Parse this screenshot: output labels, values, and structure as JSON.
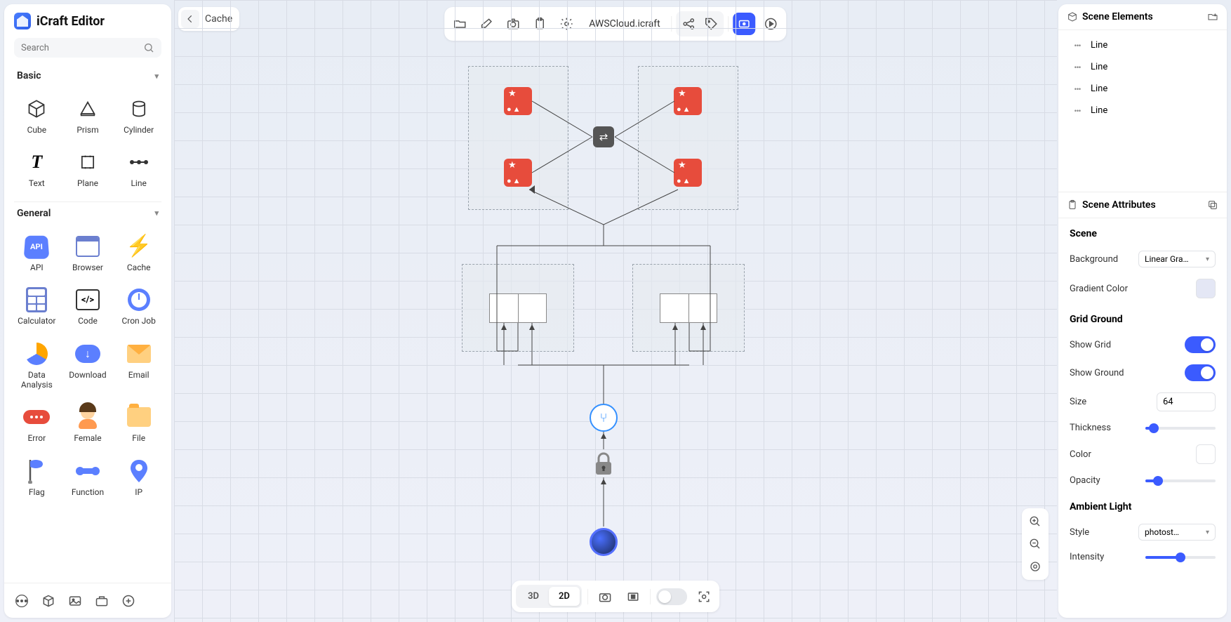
{
  "app": {
    "title": "iCraft Editor"
  },
  "search": {
    "placeholder": "Search"
  },
  "sections": {
    "basic": "Basic",
    "general": "General"
  },
  "palette_basic": [
    {
      "label": "Cube"
    },
    {
      "label": "Prism"
    },
    {
      "label": "Cylinder"
    },
    {
      "label": "Text"
    },
    {
      "label": "Plane"
    },
    {
      "label": "Line"
    }
  ],
  "palette_general": [
    {
      "label": "API"
    },
    {
      "label": "Browser"
    },
    {
      "label": "Cache"
    },
    {
      "label": "Calculator"
    },
    {
      "label": "Code"
    },
    {
      "label": "Cron Job"
    },
    {
      "label": "Data Analysis"
    },
    {
      "label": "Download"
    },
    {
      "label": "Email"
    },
    {
      "label": "Error"
    },
    {
      "label": "Female"
    },
    {
      "label": "File"
    },
    {
      "label": "Flag"
    },
    {
      "label": "Function"
    },
    {
      "label": "IP"
    }
  ],
  "breadcrumb": {
    "current": "Cache"
  },
  "file": {
    "name": "AWSCloud.icraft"
  },
  "scene_elements": {
    "title": "Scene Elements",
    "items": [
      "Line",
      "Line",
      "Line",
      "Line"
    ]
  },
  "scene_attributes": {
    "title": "Scene Attributes",
    "scene_label": "Scene",
    "background_label": "Background",
    "background_value": "Linear Gra…",
    "gradient_color_label": "Gradient Color",
    "grid_ground_label": "Grid Ground",
    "show_grid_label": "Show Grid",
    "show_grid_on": true,
    "show_ground_label": "Show Ground",
    "show_ground_on": true,
    "size_label": "Size",
    "size_value": "64",
    "thickness_label": "Thickness",
    "thickness_pct": 12,
    "color_label": "Color",
    "opacity_label": "Opacity",
    "opacity_pct": 18,
    "ambient_light_label": "Ambient Light",
    "style_label": "Style",
    "style_value": "photost…",
    "intensity_label": "Intensity",
    "intensity_pct": 50
  },
  "bottom": {
    "mode_3d": "3D",
    "mode_2d": "2D"
  }
}
